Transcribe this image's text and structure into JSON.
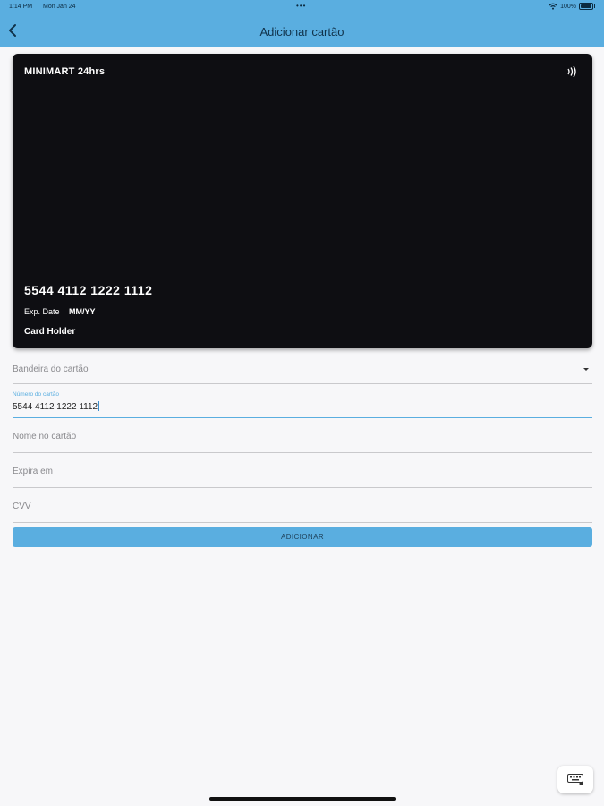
{
  "status_bar": {
    "time": "1:14 PM",
    "date": "Mon Jan 24",
    "dots": "•••",
    "battery": "100%"
  },
  "nav": {
    "title": "Adicionar cartão"
  },
  "card": {
    "brand": "MINIMART 24hrs",
    "number": "5544 4112 1222 1112",
    "exp_label": "Exp. Date",
    "exp_value": "MM/YY",
    "holder": "Card Holder"
  },
  "form": {
    "brand_placeholder": "Bandeira do cartão",
    "number_label": "Número do cartão",
    "number_value": "5544 4112 1222 1112",
    "name_placeholder": "Nome no cartão",
    "expiry_placeholder": "Expira em",
    "cvv_placeholder": "CVV",
    "submit_label": "ADICIONAR"
  },
  "colors": {
    "accent": "#5aaee0",
    "card_background": "#0e0e12",
    "page_background": "#f7f7f9"
  },
  "icons": [
    "back-chevron-icon",
    "contactless-icon",
    "dropdown-caret-icon",
    "keyboard-icon",
    "wifi-icon",
    "battery-icon"
  ]
}
